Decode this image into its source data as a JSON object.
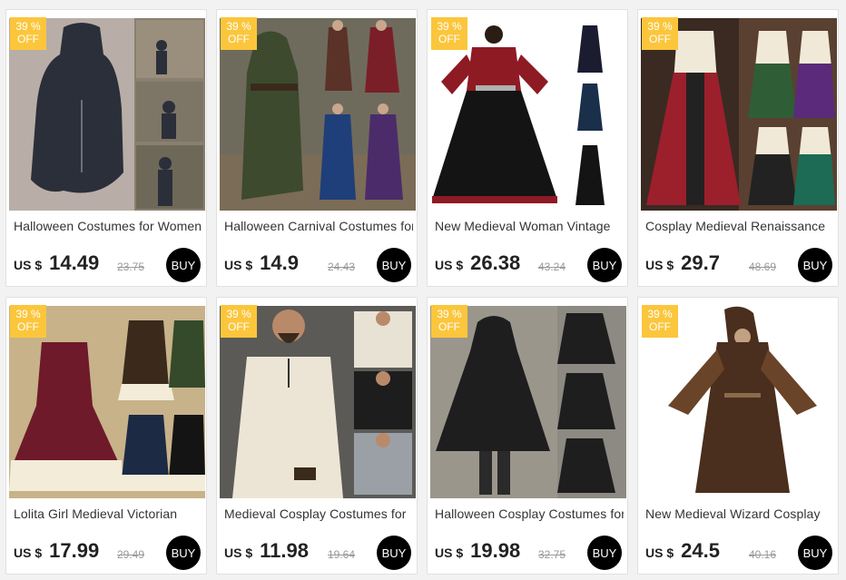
{
  "products": [
    {
      "title": "Halloween Costumes for Women",
      "currency": "US $",
      "price": "14.49",
      "old_price": "23.75",
      "badge_pct": "39 %",
      "badge_off": "OFF",
      "buy": "BUY",
      "bg": "#bcb3ad",
      "cloth": "#2b2f3a",
      "accent": "#4a4f5c"
    },
    {
      "title": "Halloween Carnival Costumes for",
      "currency": "US $",
      "price": "14.9",
      "old_price": "24.43",
      "badge_pct": "39 %",
      "badge_off": "OFF",
      "buy": "BUY",
      "bg": "#6b6858",
      "cloth": "#3c4a2e",
      "accent": "#7a2a30"
    },
    {
      "title": "New Medieval Woman Vintage",
      "currency": "US $",
      "price": "26.38",
      "old_price": "43.24",
      "badge_pct": "39 %",
      "badge_off": "OFF",
      "buy": "BUY",
      "bg": "#ffffff",
      "cloth": "#141414",
      "accent": "#8e1a24"
    },
    {
      "title": "Cosplay Medieval Renaissance",
      "currency": "US $",
      "price": "29.7",
      "old_price": "48.69",
      "badge_pct": "39 %",
      "badge_off": "OFF",
      "buy": "BUY",
      "bg": "#3a2a22",
      "cloth": "#9c1f2c",
      "accent": "#2f5d36"
    },
    {
      "title": "Lolita Girl Medieval Victorian",
      "currency": "US $",
      "price": "17.99",
      "old_price": "29.49",
      "badge_pct": "39 %",
      "badge_off": "OFF",
      "buy": "BUY",
      "bg": "#c7b28a",
      "cloth": "#6e1a2a",
      "accent": "#f2ecd8"
    },
    {
      "title": "Medieval Cosplay Costumes for",
      "currency": "US $",
      "price": "11.98",
      "old_price": "19.64",
      "badge_pct": "39 %",
      "badge_off": "OFF",
      "buy": "BUY",
      "bg": "#5b5a56",
      "cloth": "#ece5d6",
      "accent": "#1f1f1f"
    },
    {
      "title": "Halloween Cosplay Costumes for",
      "currency": "US $",
      "price": "19.98",
      "old_price": "32.75",
      "badge_pct": "39 %",
      "badge_off": "OFF",
      "buy": "BUY",
      "bg": "#8c8a82",
      "cloth": "#1e1e1e",
      "accent": "#3a3a3a"
    },
    {
      "title": "New Medieval Wizard Cosplay",
      "currency": "US $",
      "price": "24.5",
      "old_price": "40.16",
      "badge_pct": "39 %",
      "badge_off": "OFF",
      "buy": "BUY",
      "bg": "#ffffff",
      "cloth": "#4a2e1e",
      "accent": "#8a6a4a"
    }
  ]
}
